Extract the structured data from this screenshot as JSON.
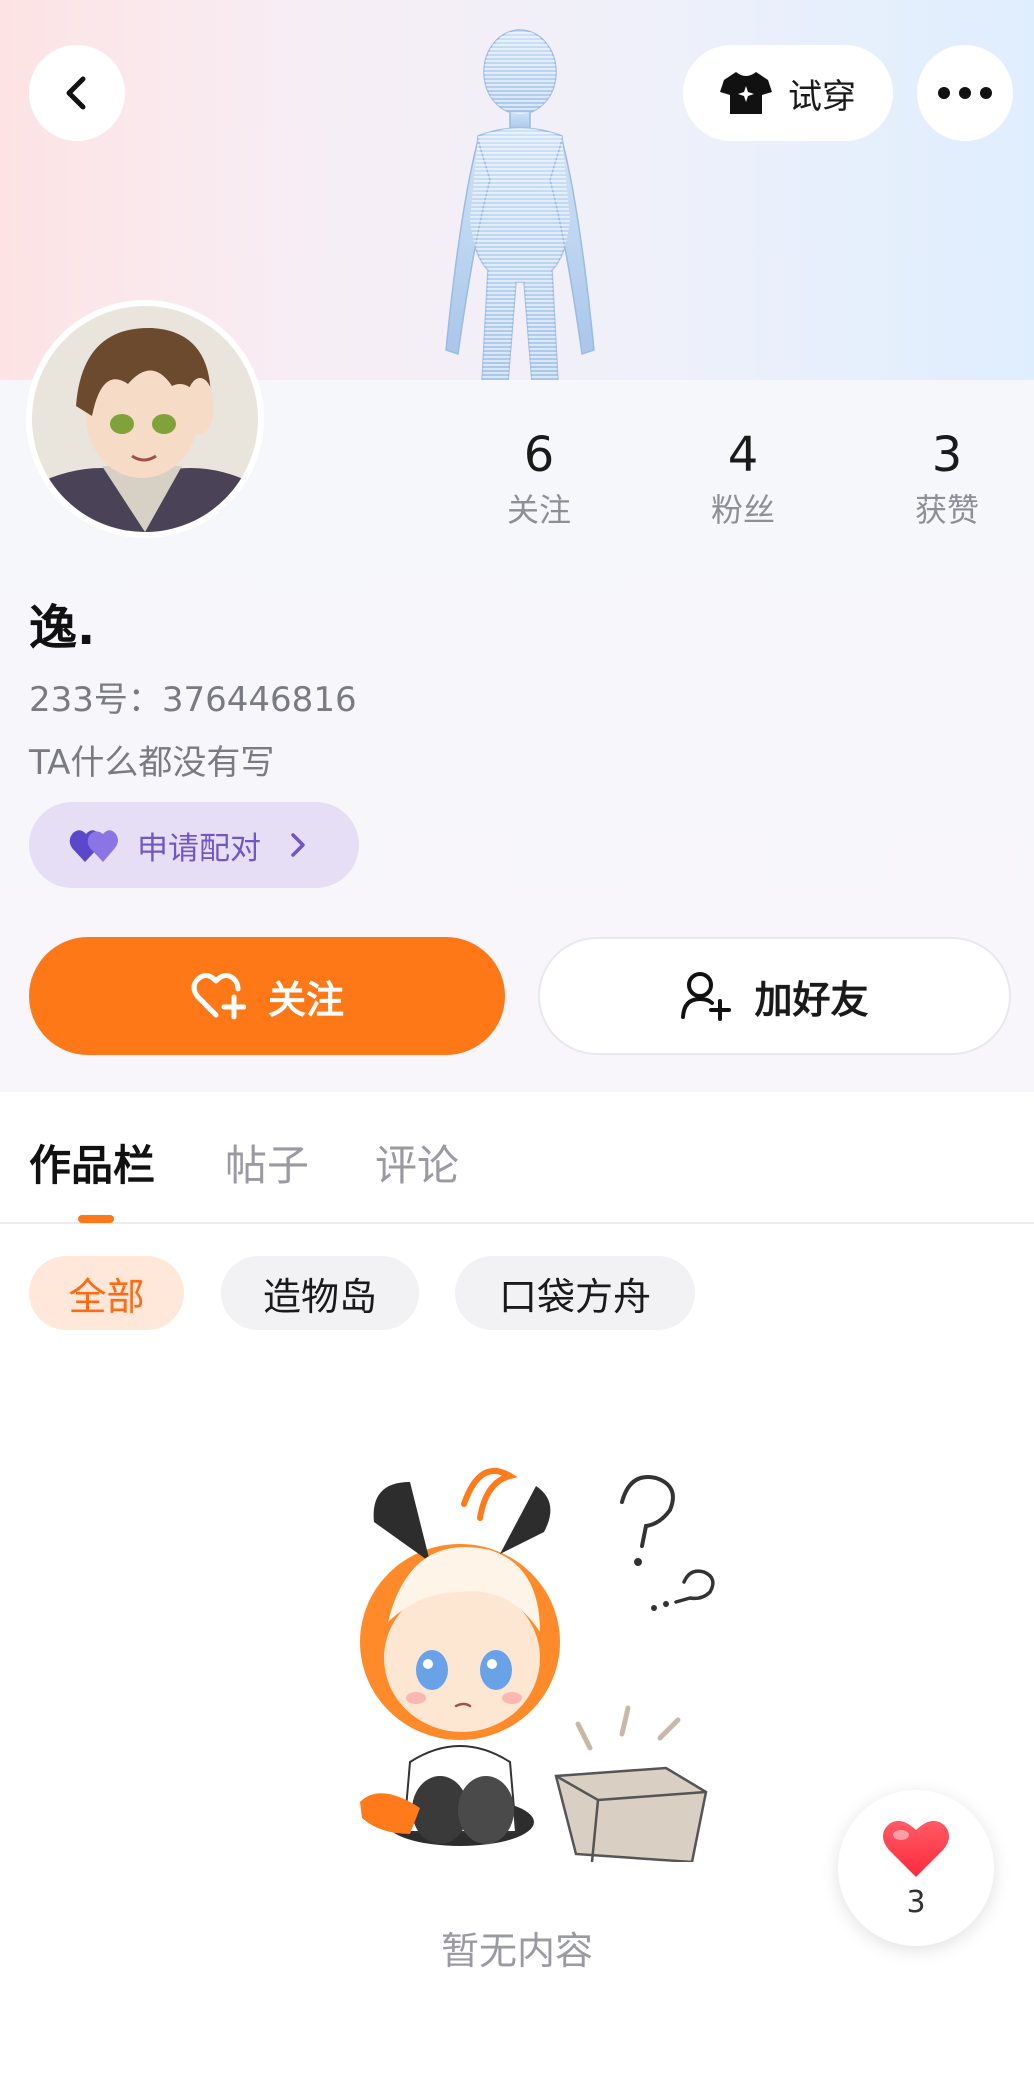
{
  "header": {
    "tryon_label": "试穿"
  },
  "profile": {
    "nickname": "逸.",
    "uid": "233号：376446816",
    "bio": "TA什么都没有写",
    "pair_label": "申请配对"
  },
  "stats": [
    {
      "value": "6",
      "label": "关注"
    },
    {
      "value": "4",
      "label": "粉丝"
    },
    {
      "value": "3",
      "label": "获赞"
    }
  ],
  "actions": {
    "follow_label": "关注",
    "add_friend_label": "加好友"
  },
  "tabs": [
    {
      "label": "作品栏",
      "active": true
    },
    {
      "label": "帖子",
      "active": false
    },
    {
      "label": "评论",
      "active": false
    }
  ],
  "filters": [
    {
      "label": "全部",
      "active": true
    },
    {
      "label": "造物岛",
      "active": false
    },
    {
      "label": "口袋方舟",
      "active": false
    }
  ],
  "empty_state": {
    "text": "暂无内容"
  },
  "like_widget": {
    "count": "3"
  },
  "colors": {
    "accent": "#ff7817",
    "pair_bg": "#e6def5",
    "pair_text": "#6e58c8",
    "like_heart": "#ff3b4a"
  }
}
